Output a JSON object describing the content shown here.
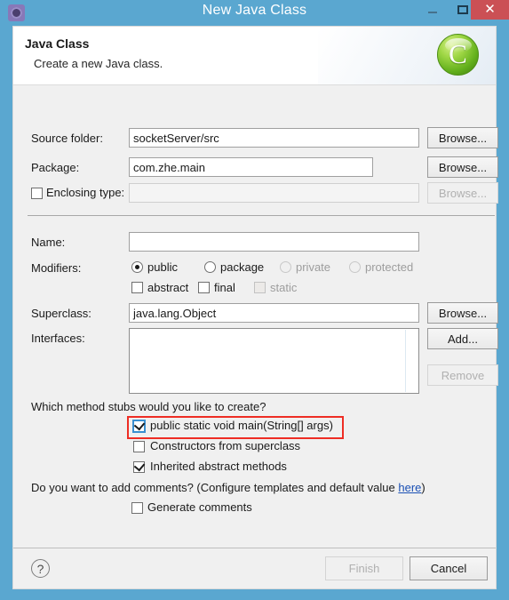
{
  "window": {
    "title": "New Java Class",
    "icon": "gear-icon",
    "controls": {
      "minimize": "–",
      "maximize": "□",
      "close": "✕"
    },
    "titlebar_color": "#5aa7d0",
    "close_color": "#cb5055"
  },
  "header": {
    "title": "Java Class",
    "subtitle": "Create a new Java class.",
    "icon_letter": "C",
    "icon_color": "#7ec42a"
  },
  "form": {
    "source_folder": {
      "label": "Source folder:",
      "value": "socketServer/src",
      "button": "Browse..."
    },
    "package": {
      "label": "Package:",
      "value": "com.zhe.main",
      "button": "Browse..."
    },
    "enclosing_type": {
      "label": "Enclosing type:",
      "value": "",
      "button": "Browse...",
      "checked": false,
      "enabled": false
    },
    "name": {
      "label": "Name:",
      "value": ""
    },
    "modifiers": {
      "label": "Modifiers:",
      "radios": [
        {
          "label": "public",
          "selected": true,
          "enabled": true
        },
        {
          "label": "package",
          "selected": false,
          "enabled": true
        },
        {
          "label": "private",
          "selected": false,
          "enabled": false
        },
        {
          "label": "protected",
          "selected": false,
          "enabled": false
        }
      ],
      "checkboxes": [
        {
          "label": "abstract",
          "checked": false,
          "enabled": true
        },
        {
          "label": "final",
          "checked": false,
          "enabled": true
        },
        {
          "label": "static",
          "checked": false,
          "enabled": false
        }
      ]
    },
    "superclass": {
      "label": "Superclass:",
      "value": "java.lang.Object",
      "button": "Browse..."
    },
    "interfaces": {
      "label": "Interfaces:",
      "items": [],
      "add_button": "Add...",
      "remove_button": "Remove"
    },
    "method_stubs": {
      "question": "Which method stubs would you like to create?",
      "options": [
        {
          "label": "public static void main(String[] args)",
          "checked": true,
          "highlighted": true
        },
        {
          "label": "Constructors from superclass",
          "checked": false,
          "highlighted": false
        },
        {
          "label": "Inherited abstract methods",
          "checked": true,
          "highlighted": false
        }
      ]
    },
    "comments": {
      "question_prefix": "Do you want to add comments? (Configure templates and default value ",
      "link": "here",
      "question_suffix": ")",
      "checkbox": {
        "label": "Generate comments",
        "checked": false
      }
    }
  },
  "footer": {
    "help": "?",
    "finish": {
      "label": "Finish",
      "enabled": false
    },
    "cancel": {
      "label": "Cancel",
      "enabled": true
    }
  },
  "highlight_color": "#ee2d24"
}
